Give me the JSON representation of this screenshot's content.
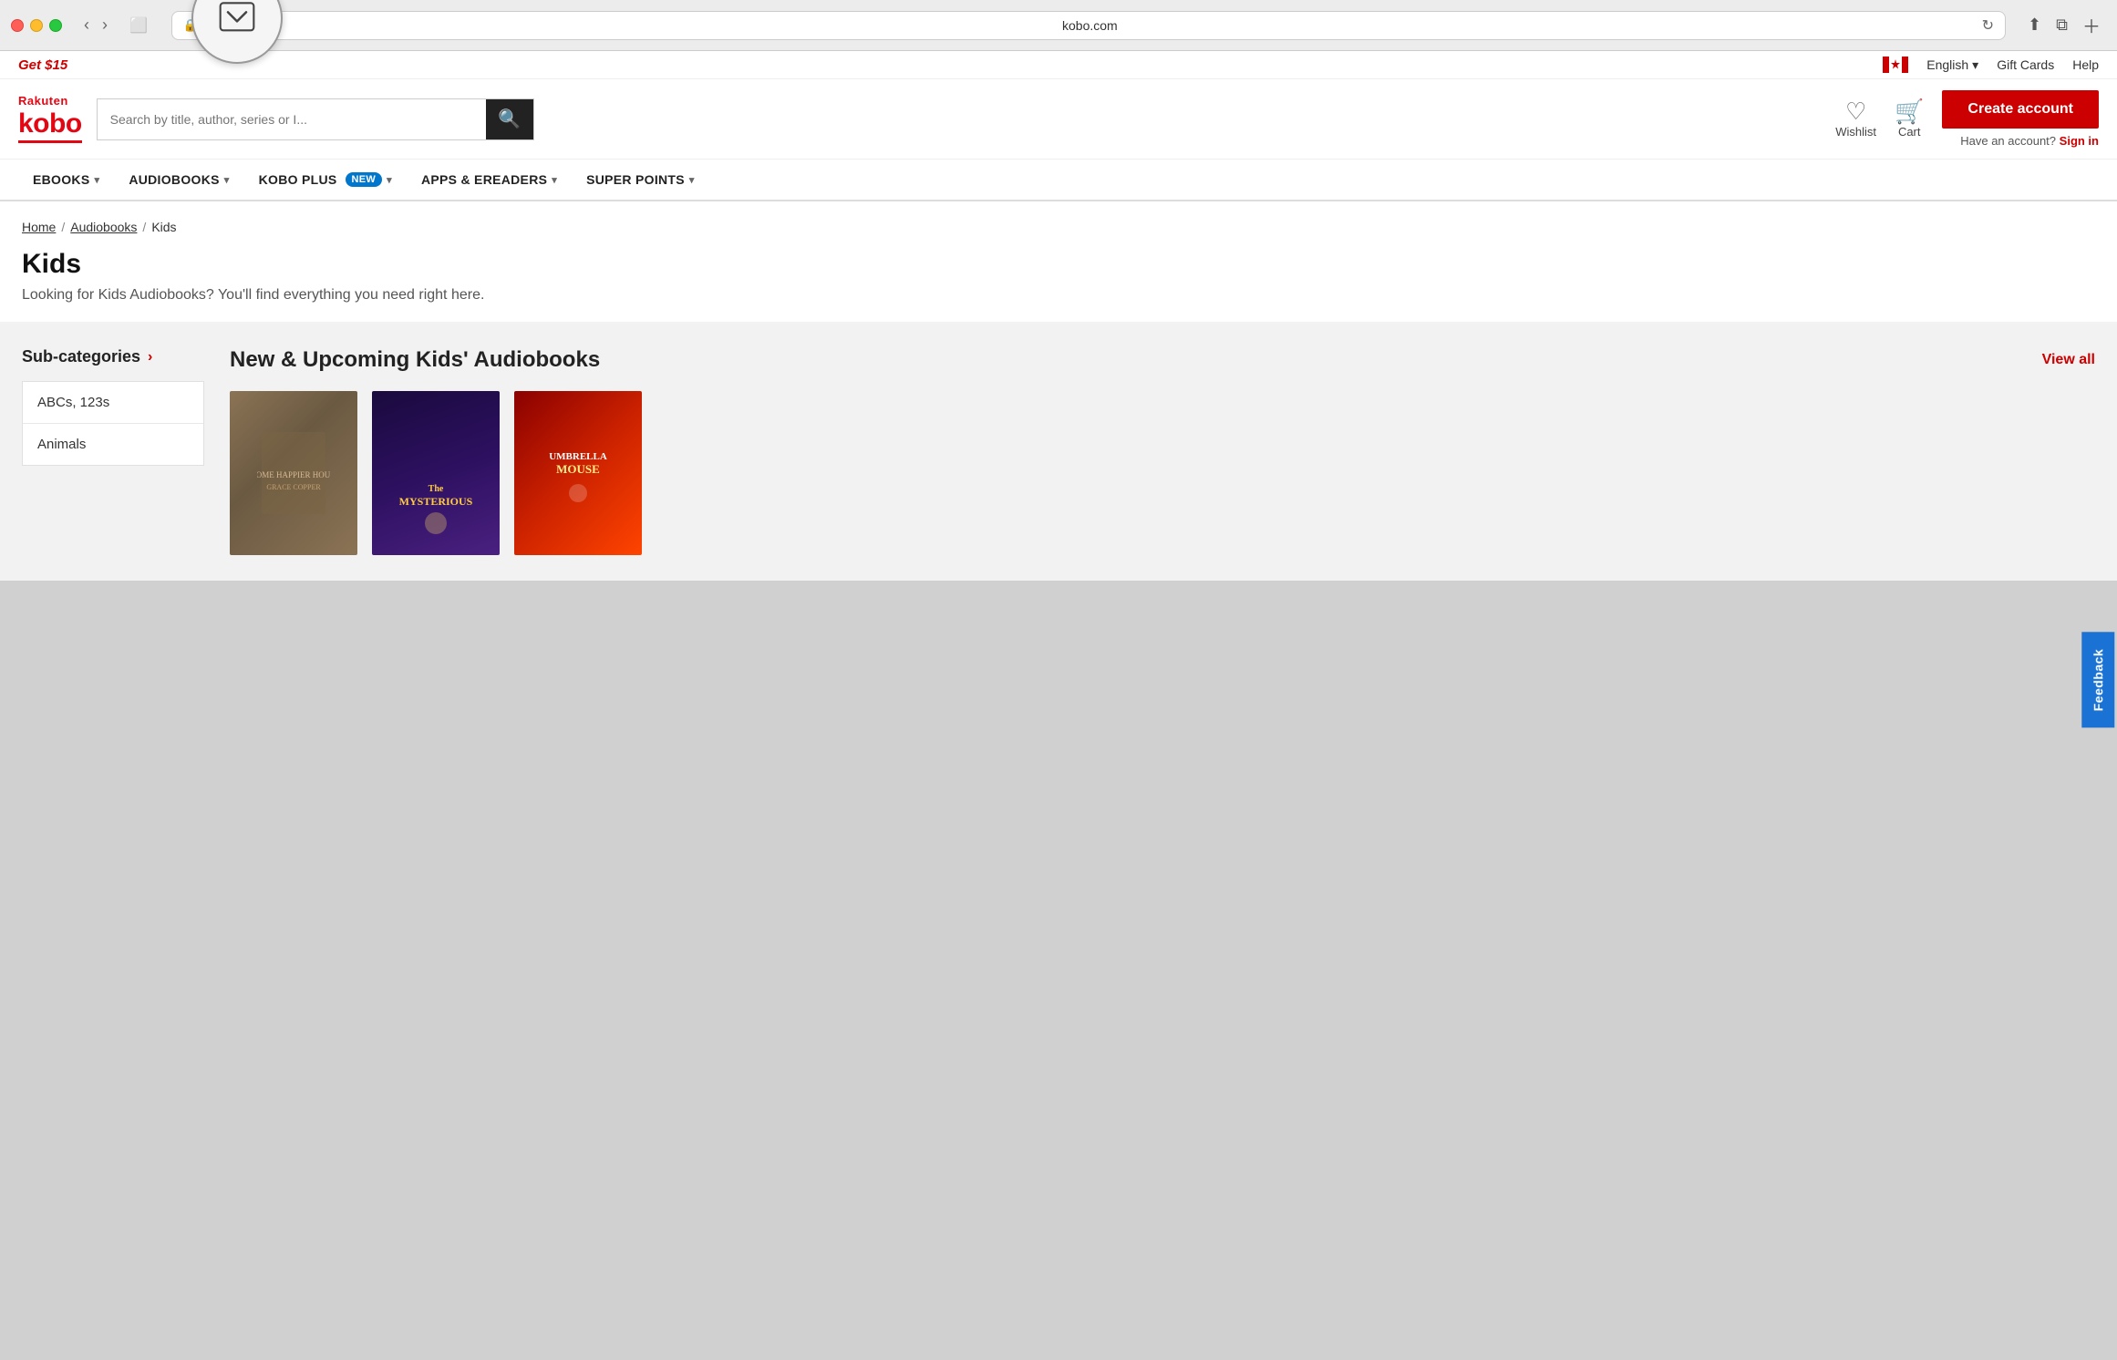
{
  "browser": {
    "url": "kobo.com",
    "lock_icon": "🔒"
  },
  "promo": {
    "text": "Get $15",
    "canada_label": "",
    "english_label": "English",
    "gift_cards_label": "Gift Cards",
    "help_label": "Help"
  },
  "header": {
    "logo_rakuten": "Rakuten",
    "logo_kobo": "kobo",
    "search_placeholder": "Search by title, author, series or I...",
    "wishlist_label": "Wishlist",
    "cart_label": "Cart",
    "create_account_label": "Create account",
    "have_account_text": "Have an account?",
    "sign_in_label": "Sign in"
  },
  "nav": {
    "items": [
      {
        "label": "eBOOKS",
        "has_dropdown": true,
        "badge": null
      },
      {
        "label": "AUDIOBOOKS",
        "has_dropdown": true,
        "badge": null
      },
      {
        "label": "KOBO PLUS",
        "has_dropdown": true,
        "badge": "NEW"
      },
      {
        "label": "APPS & eREADERS",
        "has_dropdown": true,
        "badge": null
      },
      {
        "label": "SUPER POINTS",
        "has_dropdown": true,
        "badge": null
      }
    ]
  },
  "breadcrumb": {
    "home": "Home",
    "audiobooks": "Audiobooks",
    "current": "Kids"
  },
  "page": {
    "title": "Kids",
    "subtitle": "Looking for Kids Audiobooks? You'll find everything you need right here."
  },
  "subcategories": {
    "title": "Sub-categories",
    "items": [
      {
        "label": "ABCs, 123s"
      },
      {
        "label": "Animals"
      }
    ]
  },
  "section": {
    "title": "New & Upcoming Kids' Audiobooks",
    "view_all": "View all"
  },
  "books": [
    {
      "id": 1,
      "style": "brown"
    },
    {
      "id": 2,
      "style": "purple"
    },
    {
      "id": 3,
      "style": "red"
    }
  ],
  "feedback": {
    "label": "Feedback"
  }
}
